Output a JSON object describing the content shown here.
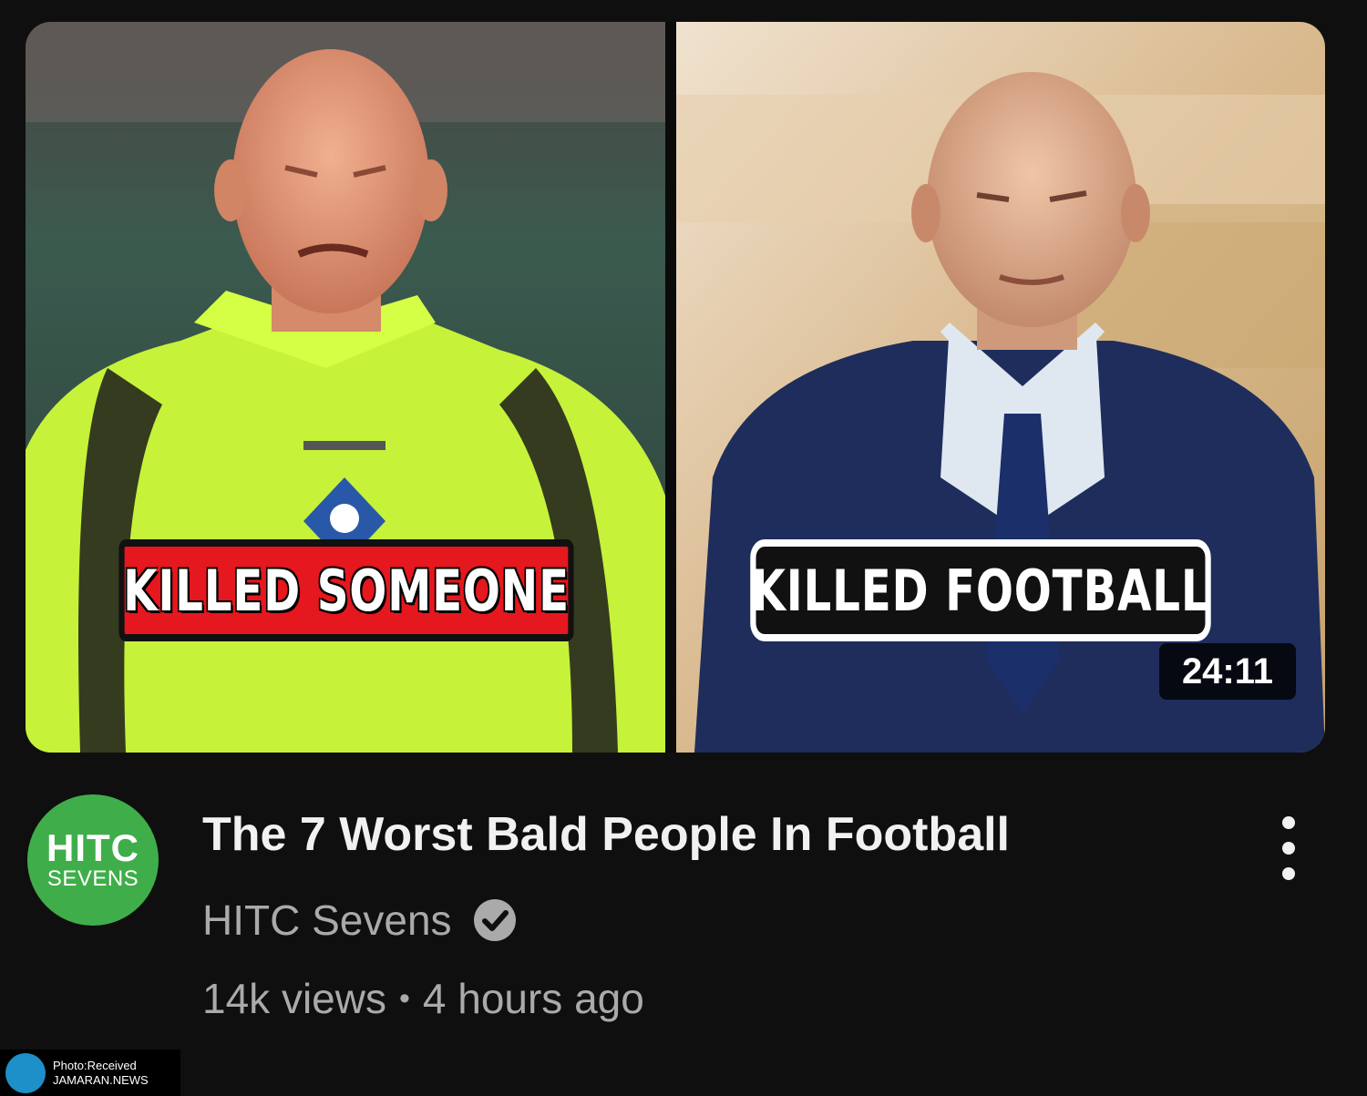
{
  "video": {
    "thumbnail": {
      "left_caption": "Killed Someone",
      "right_caption": "Killed Football",
      "duration": "24:11"
    },
    "title": "The 7 Worst Bald People In Football",
    "channel": {
      "name": "HITC Sevens",
      "avatar_line1": "HITC",
      "avatar_line2": "SEVENS",
      "avatar_color": "#3fae4a",
      "verified": true
    },
    "views": "14k views",
    "separator": "•",
    "age": "4 hours ago",
    "more_icon": "more-vert-icon"
  },
  "watermark": {
    "line1": "Photo:Received",
    "line2": "JAMARAN.NEWS"
  },
  "colors": {
    "background": "#0f0f0f",
    "title": "#f1f1f1",
    "secondary_text": "#aaaaaa",
    "caption_red": "#e4181e"
  }
}
